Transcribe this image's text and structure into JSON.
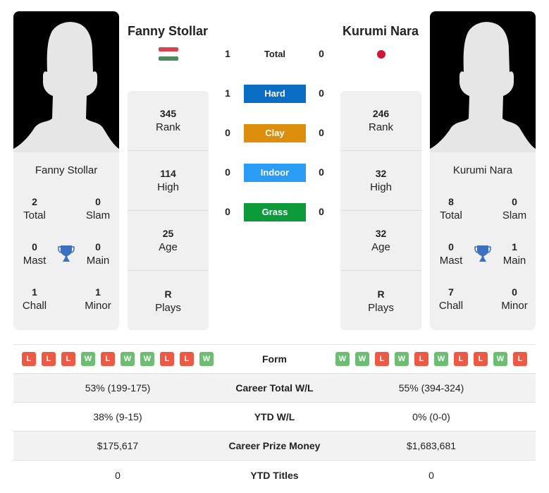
{
  "colors": {
    "hard": "#0a6ec4",
    "clay": "#dd8e0c",
    "indoor": "#2a9cf5",
    "grass": "#0c9a3a",
    "win": "#6dbd72",
    "loss": "#ec5a45",
    "trophy": "#3c6fbf"
  },
  "player1": {
    "name": "Fanny Stollar",
    "flag": "hungary-flag",
    "rank": "345",
    "rank_label": "Rank",
    "high": "114",
    "high_label": "High",
    "age": "25",
    "age_label": "Age",
    "plays": "R",
    "plays_label": "Plays",
    "titles": {
      "total": "2",
      "total_label": "Total",
      "slam": "0",
      "slam_label": "Slam",
      "mast": "0",
      "mast_label": "Mast",
      "main": "0",
      "main_label": "Main",
      "chall": "1",
      "chall_label": "Chall",
      "minor": "1",
      "minor_label": "Minor"
    },
    "form": [
      "L",
      "L",
      "L",
      "W",
      "L",
      "W",
      "W",
      "L",
      "L",
      "W"
    ],
    "career_wl": "53% (199-175)",
    "ytd_wl": "38% (9-15)",
    "prize_money": "$175,617",
    "ytd_titles": "0"
  },
  "player2": {
    "name": "Kurumi Nara",
    "flag": "japan-flag",
    "rank": "246",
    "rank_label": "Rank",
    "high": "32",
    "high_label": "High",
    "age": "32",
    "age_label": "Age",
    "plays": "R",
    "plays_label": "Plays",
    "titles": {
      "total": "8",
      "total_label": "Total",
      "slam": "0",
      "slam_label": "Slam",
      "mast": "0",
      "mast_label": "Mast",
      "main": "1",
      "main_label": "Main",
      "chall": "7",
      "chall_label": "Chall",
      "minor": "0",
      "minor_label": "Minor"
    },
    "form": [
      "W",
      "W",
      "L",
      "W",
      "L",
      "W",
      "L",
      "L",
      "W",
      "L"
    ],
    "career_wl": "55% (394-324)",
    "ytd_wl": "0% (0-0)",
    "prize_money": "$1,683,681",
    "ytd_titles": "0"
  },
  "h2h": [
    {
      "label": "Total",
      "p1": "1",
      "p2": "0"
    },
    {
      "label": "Hard",
      "p1": "1",
      "p2": "0"
    },
    {
      "label": "Clay",
      "p1": "0",
      "p2": "0"
    },
    {
      "label": "Indoor",
      "p1": "0",
      "p2": "0"
    },
    {
      "label": "Grass",
      "p1": "0",
      "p2": "0"
    }
  ],
  "compare_labels": {
    "form": "Form",
    "career_wl": "Career Total W/L",
    "ytd_wl": "YTD W/L",
    "prize_money": "Career Prize Money",
    "ytd_titles": "YTD Titles"
  }
}
